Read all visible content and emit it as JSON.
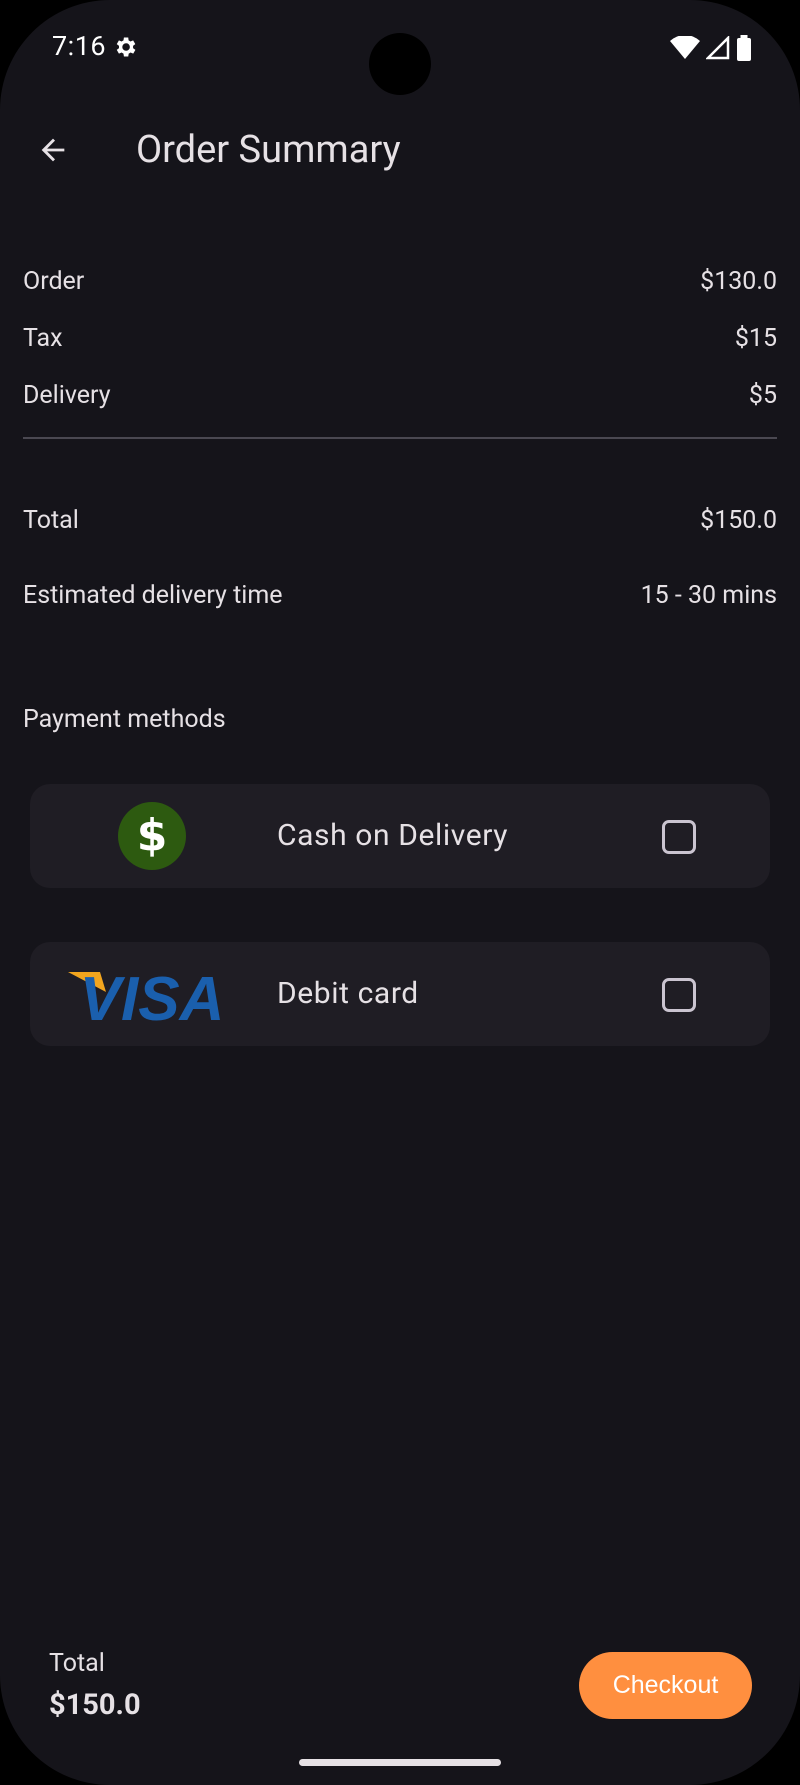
{
  "status_bar": {
    "time": "7:16",
    "icons": [
      "settings-gear-icon",
      "wifi-icon",
      "cell-signal-icon",
      "battery-icon"
    ]
  },
  "header": {
    "back_icon": "arrow-back-icon",
    "title": "Order Summary"
  },
  "summary": {
    "rows": [
      {
        "label": "Order",
        "value": "$130.0"
      },
      {
        "label": "Tax",
        "value": "$15"
      },
      {
        "label": "Delivery",
        "value": "$5"
      }
    ],
    "total": {
      "label": "Total",
      "value": "$150.0"
    },
    "delivery_time": {
      "label": "Estimated delivery time",
      "value": "15 - 30 mins"
    }
  },
  "payment": {
    "section_label": "Payment methods",
    "methods": [
      {
        "label": "Cash on Delivery",
        "icon": "dollar-coin-icon",
        "icon_glyph": "$",
        "checked": false
      },
      {
        "label": "Debit card",
        "icon": "visa-logo",
        "logo_text": "VISA",
        "checked": false
      }
    ]
  },
  "footer": {
    "total_label": "Total",
    "total_value": "$150.0",
    "checkout_label": "Checkout"
  },
  "colors": {
    "background": "#15141a",
    "card": "#1f1d24",
    "accent": "#ff8f3f",
    "text": "#e6e1e5",
    "cash_icon": "#2d5a10",
    "visa_blue": "#1a5fad",
    "visa_gold": "#f2a51e"
  }
}
